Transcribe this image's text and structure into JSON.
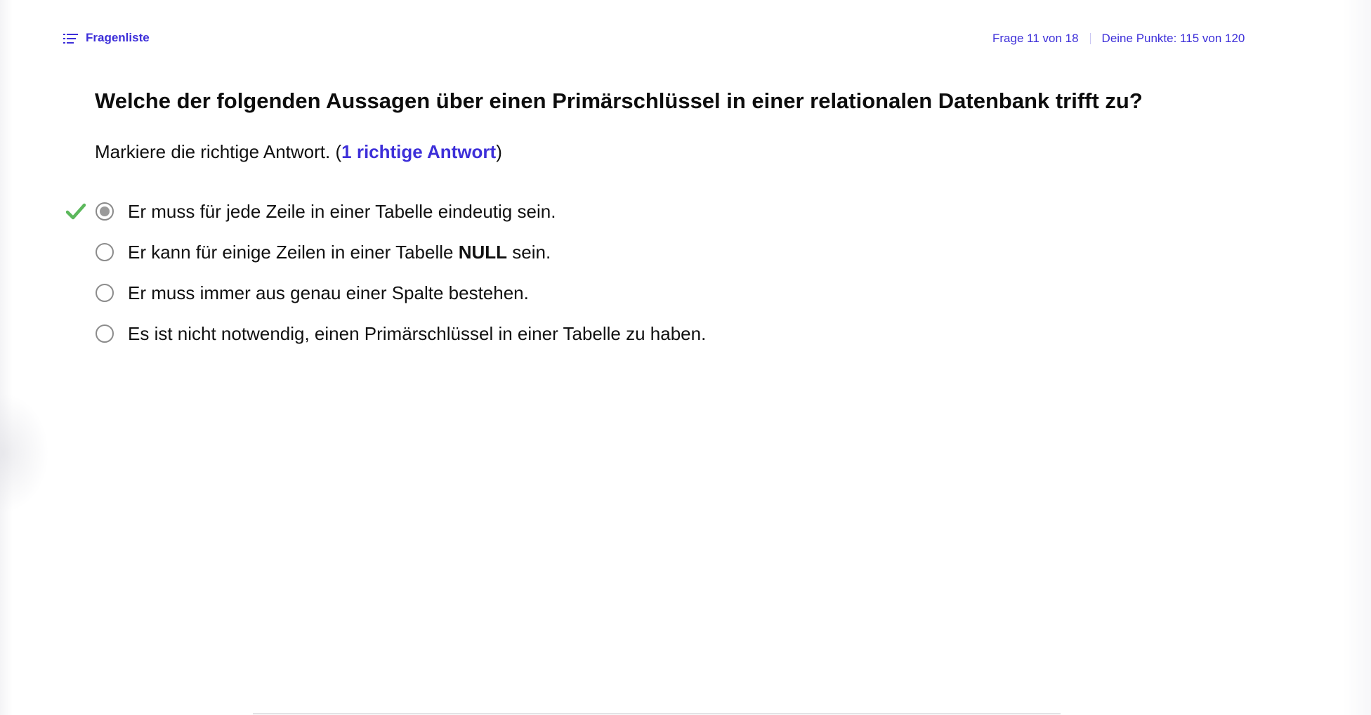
{
  "header": {
    "question_list_label": "Fragenliste",
    "question_progress": "Frage 11 von 18",
    "points": "Deine Punkte: 115 von 120"
  },
  "question": {
    "title": "Welche der folgenden Aussagen über einen Primärschlüssel in einer relationalen Datenbank trifft zu?",
    "instruction_prefix": "Markiere die richtige Antwort. (",
    "instruction_highlight": "1 richtige Antwort",
    "instruction_suffix": ")"
  },
  "options": [
    {
      "text_before": "Er muss für jede Zeile in einer Tabelle eindeutig sein.",
      "bold": "",
      "text_after": "",
      "selected": true,
      "correct": true
    },
    {
      "text_before": "Er kann für einige Zeilen in einer Tabelle ",
      "bold": "NULL",
      "text_after": " sein.",
      "selected": false,
      "correct": false
    },
    {
      "text_before": "Er muss immer aus genau einer Spalte bestehen.",
      "bold": "",
      "text_after": "",
      "selected": false,
      "correct": false
    },
    {
      "text_before": "Es ist nicht notwendig, einen Primärschlüssel in einer Tabelle zu haben.",
      "bold": "",
      "text_after": "",
      "selected": false,
      "correct": false
    }
  ],
  "colors": {
    "accent": "#3d2fd9",
    "correct_check": "#5cb85c",
    "radio_border": "#8c8c8c",
    "radio_selected_fill": "#9a9a9a"
  },
  "icons": {
    "question_list": "list-icon",
    "correct": "checkmark-icon"
  }
}
